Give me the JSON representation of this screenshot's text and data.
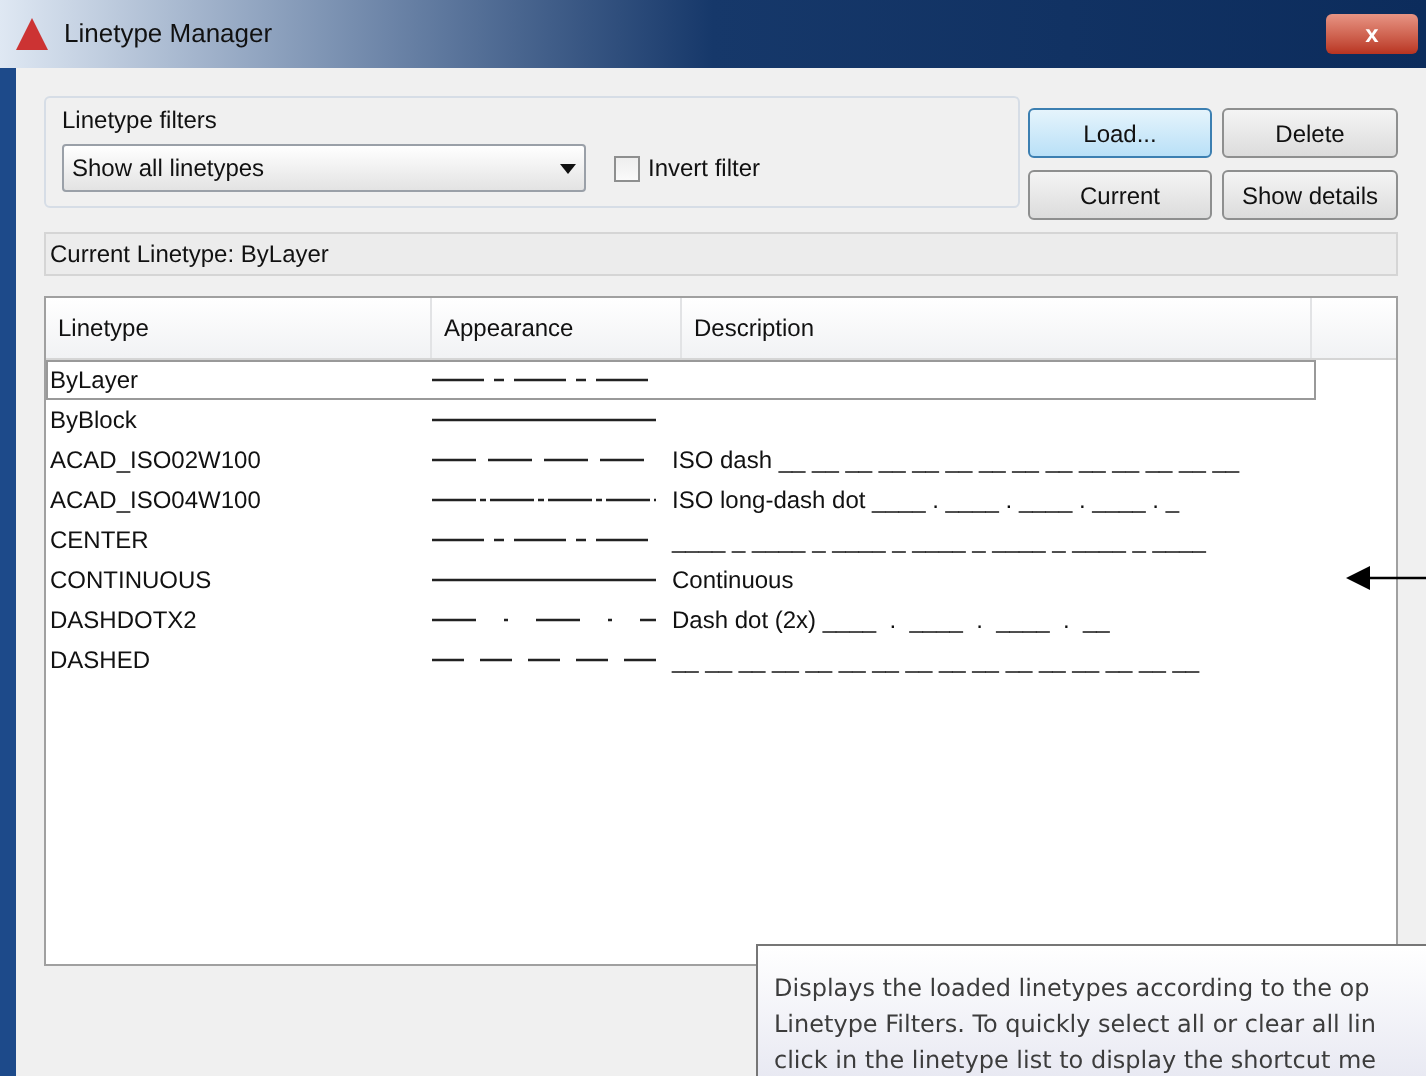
{
  "window": {
    "title": "Linetype Manager",
    "close_label": "x"
  },
  "filters": {
    "legend": "Linetype filters",
    "dropdown_value": "Show all linetypes",
    "invert": {
      "label": "Invert filter",
      "checked": false
    }
  },
  "buttons": [
    {
      "label": "Load...",
      "focused": true
    },
    {
      "label": "Delete",
      "focused": false
    },
    {
      "label": "Current",
      "focused": false
    },
    {
      "label": "Show details",
      "focused": false
    }
  ],
  "current_linetype": "Current Linetype:  ByLayer",
  "table": {
    "columns": [
      "Linetype",
      "Appearance",
      "Description"
    ],
    "rows": [
      {
        "name": "ByLayer",
        "kind": "center",
        "description": "",
        "selected": true
      },
      {
        "name": "ByBlock",
        "kind": "continuous",
        "description": "",
        "selected": false
      },
      {
        "name": "ACAD_ISO02W100",
        "kind": "iso_dash",
        "description": "ISO dash __ __ __ __ __ __ __ __ __ __ __ __ __ __",
        "selected": false
      },
      {
        "name": "ACAD_ISO04W100",
        "kind": "long_dash_dot",
        "description": "ISO long-dash dot ____ . ____ . ____ . ____ . _",
        "selected": false
      },
      {
        "name": "CENTER",
        "kind": "center",
        "description": "____ _ ____ _ ____ _ ____ _ ____ _ ____ _ ____",
        "selected": false
      },
      {
        "name": "CONTINUOUS",
        "kind": "continuous",
        "description": "Continuous",
        "selected": false
      },
      {
        "name": "DASHDOTX2",
        "kind": "dash_dot",
        "description": "Dash dot (2x) ____  .  ____  .  ____  .  __",
        "selected": false
      },
      {
        "name": "DASHED",
        "kind": "dashed",
        "description": "__ __ __ __ __ __ __ __ __ __ __ __ __ __ __ __",
        "selected": false
      }
    ]
  },
  "tooltip": {
    "lines": [
      "Displays the loaded linetypes according to the op",
      "Linetype Filters. To quickly select all or clear all lin",
      "click in the linetype list to display the shortcut me"
    ]
  }
}
